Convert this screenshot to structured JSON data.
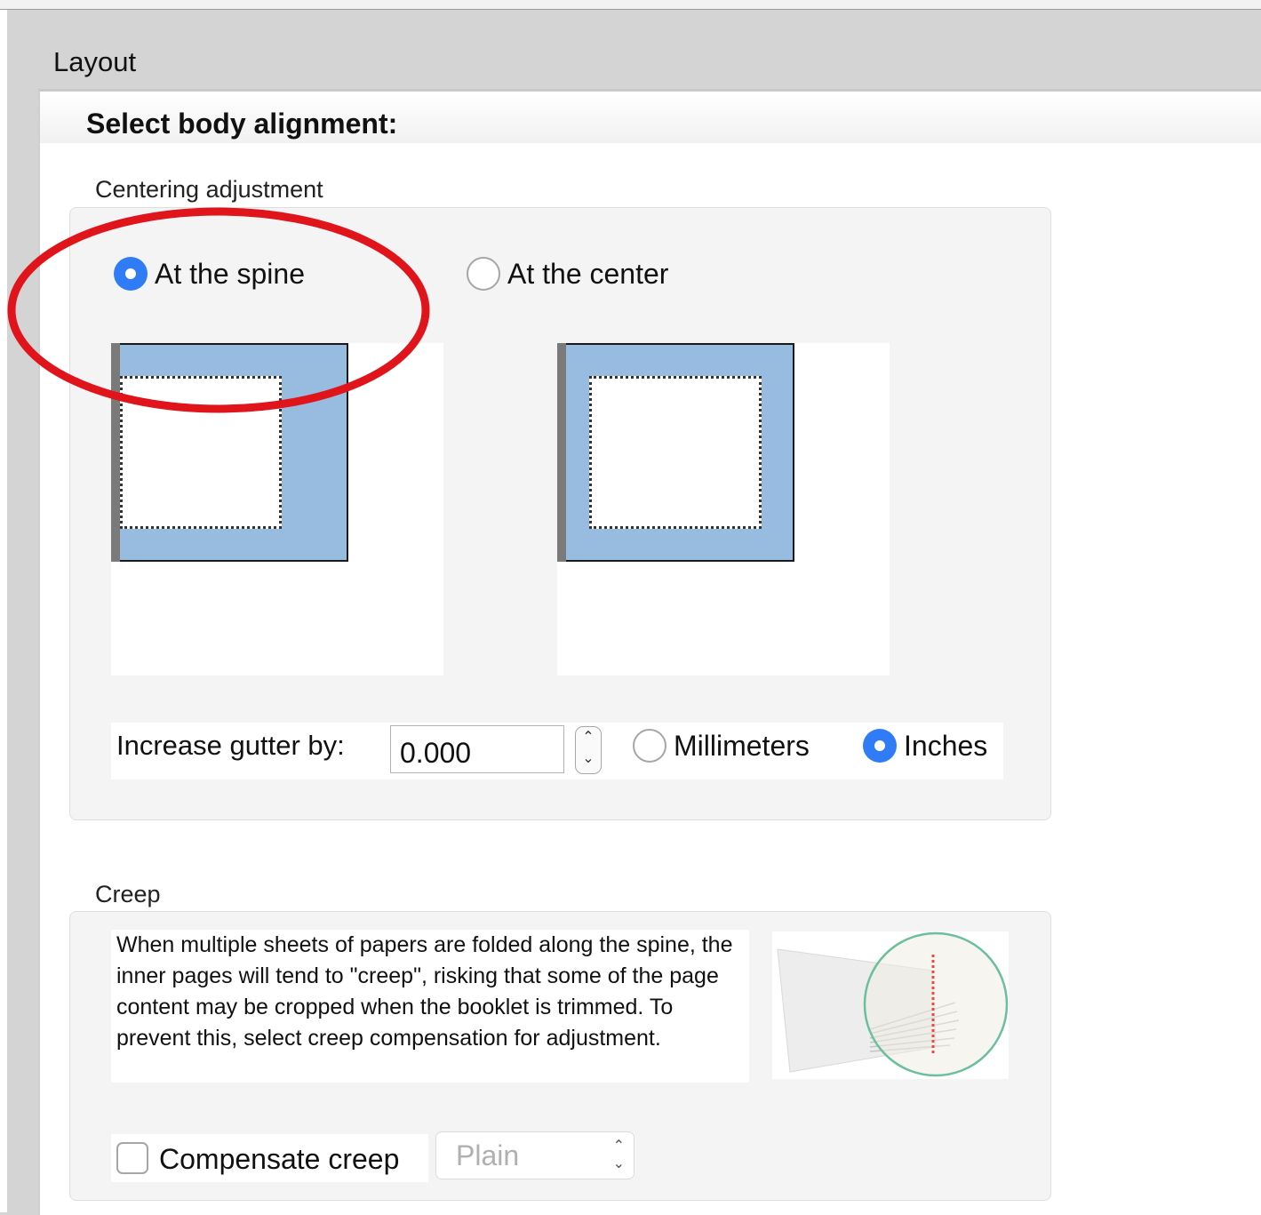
{
  "window": {
    "title": "Layout"
  },
  "heading": "Select body alignment:",
  "centering": {
    "label": "Centering adjustment",
    "options": [
      {
        "label": "At the spine",
        "selected": true
      },
      {
        "label": "At the center",
        "selected": false
      }
    ],
    "gutter": {
      "label": "Increase gutter by:",
      "value": "0.000",
      "stepper_up": "⌃",
      "stepper_down": "⌄"
    },
    "units": [
      {
        "label": "Millimeters",
        "selected": false
      },
      {
        "label": "Inches",
        "selected": true
      }
    ]
  },
  "creep": {
    "label": "Creep",
    "description": "When multiple sheets of papers are folded along the spine, the inner pages will tend to \"creep\", risking that some of the page content may be cropped when the booklet is trimmed. To prevent this, select creep compensation for adjustment.",
    "compensate_label": "Compensate creep",
    "compensate_checked": false,
    "mode_value": "Plain",
    "select_arrows": "⌃⌄"
  },
  "colors": {
    "accent": "#2f7cf6",
    "page_fill": "#98bbe0",
    "annotation": "#e0151b"
  }
}
